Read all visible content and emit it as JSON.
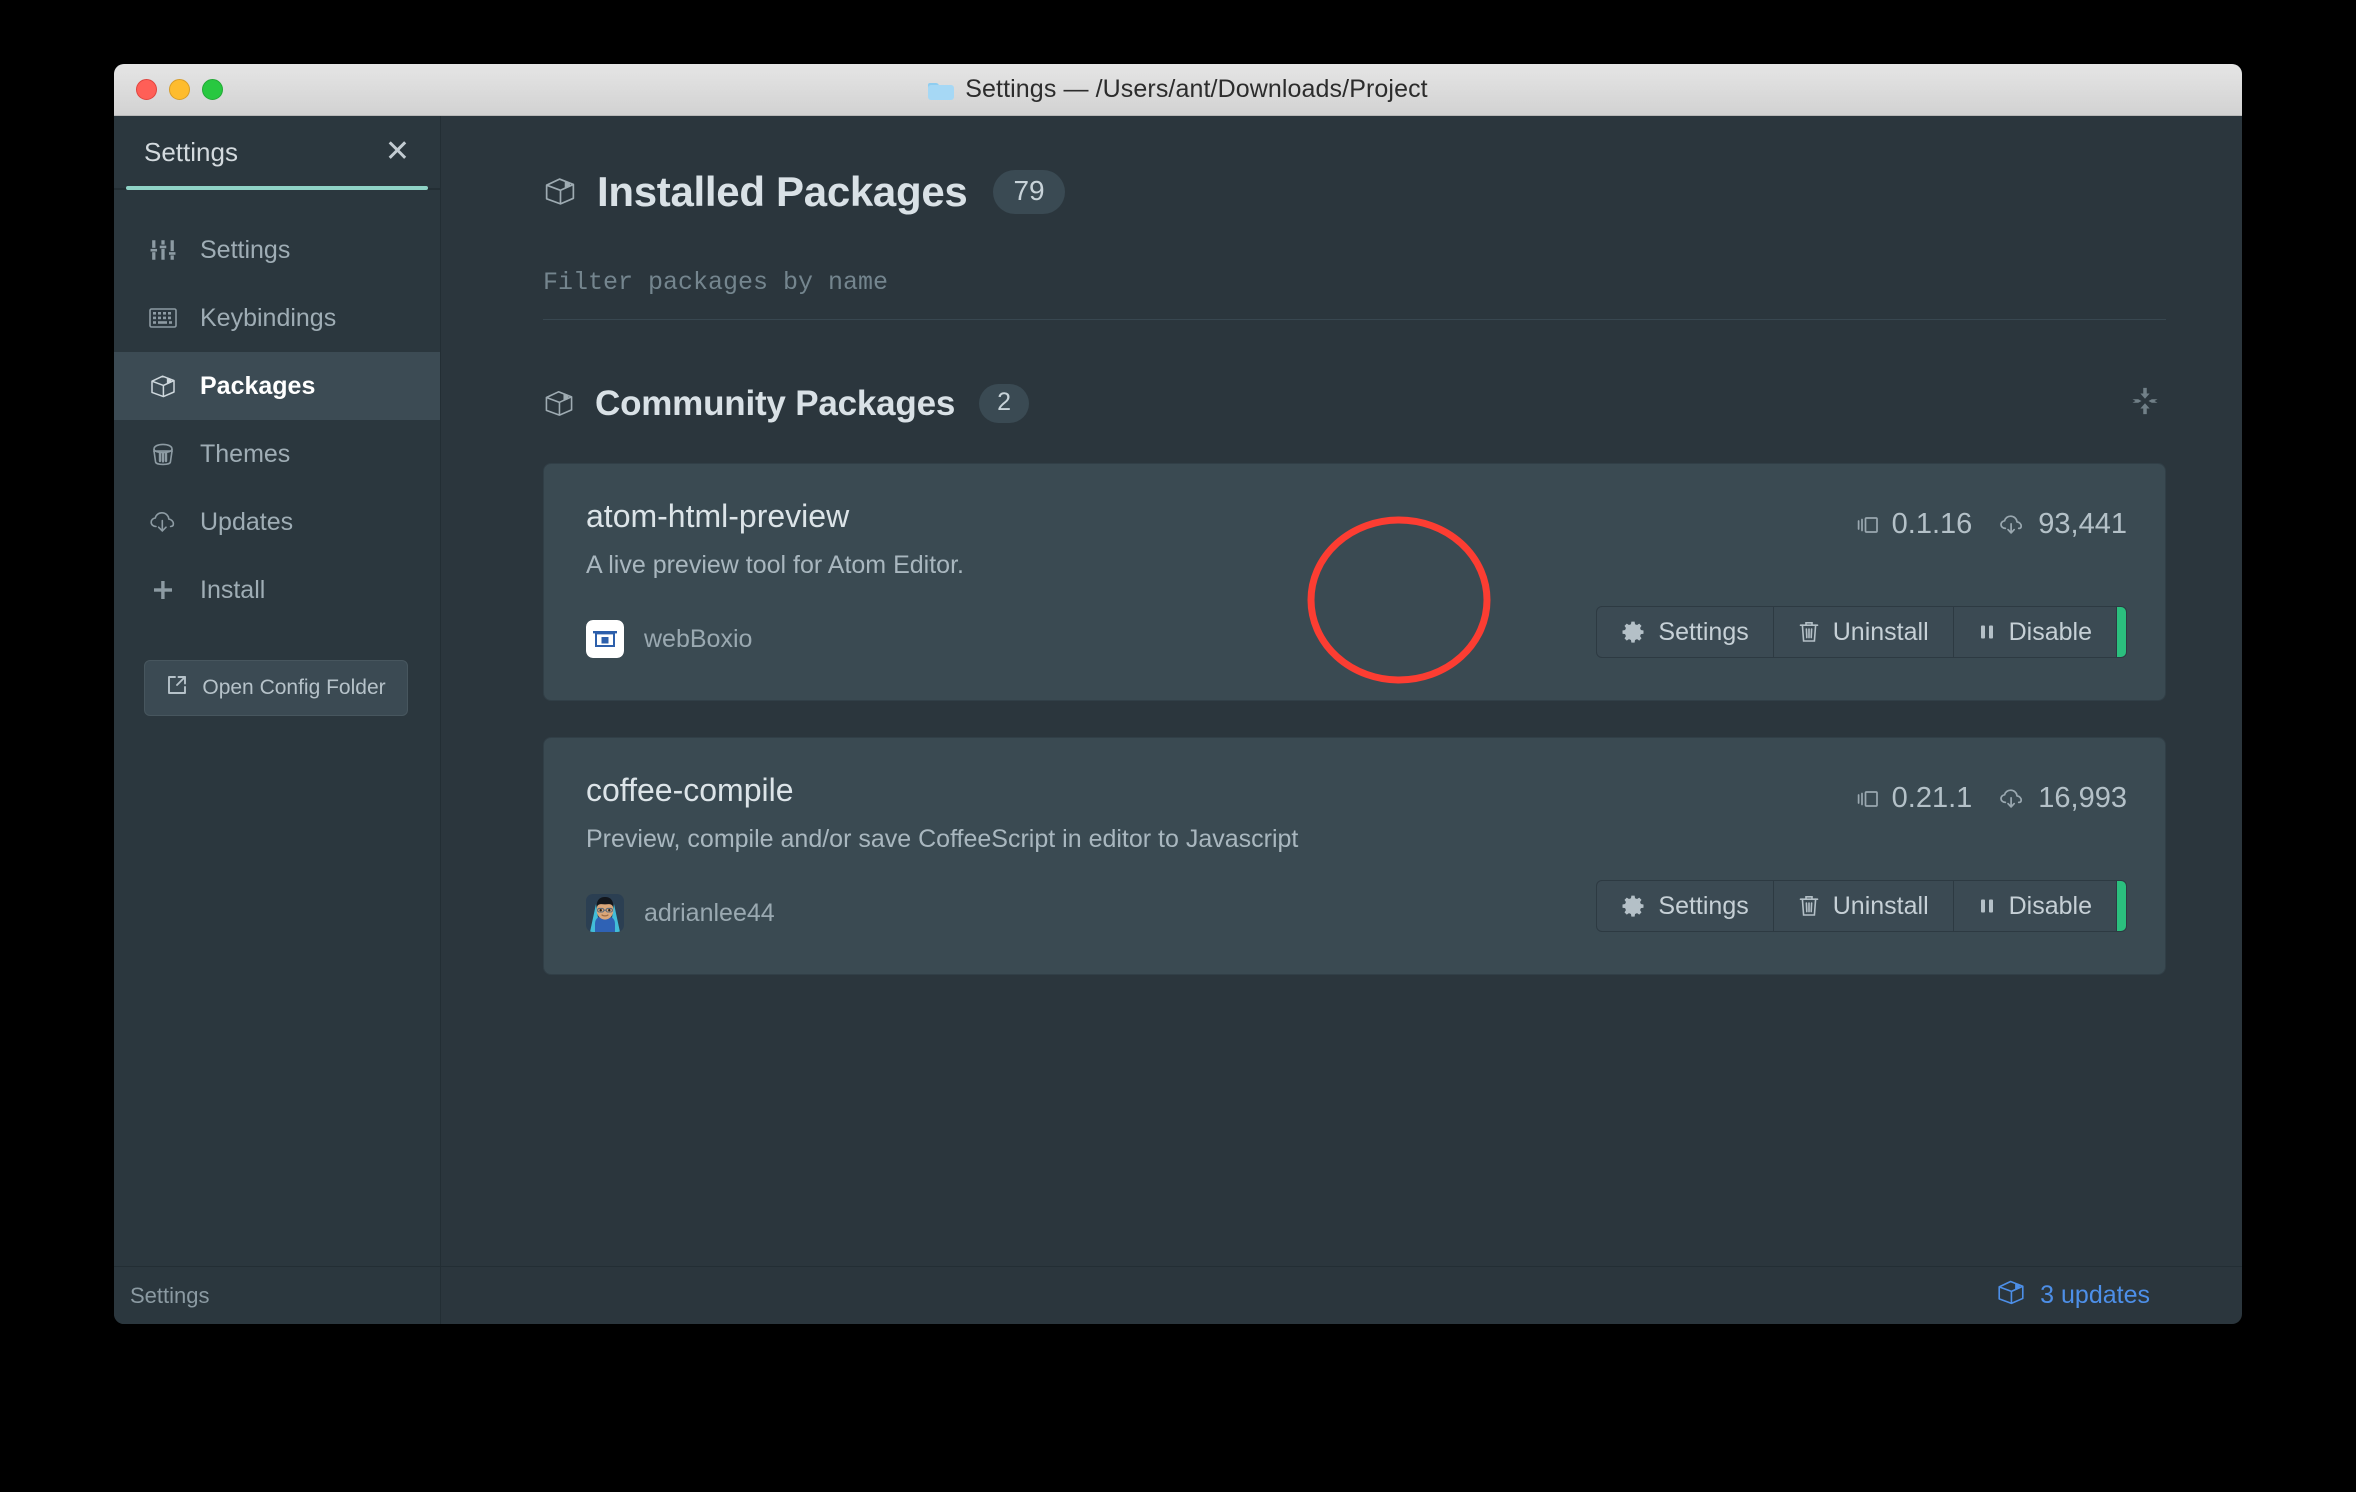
{
  "window": {
    "title": "Settings — /Users/ant/Downloads/Project",
    "folder_icon": "folder-icon",
    "traffic_lights": [
      "close",
      "minimize",
      "zoom"
    ]
  },
  "tab": {
    "label": "Settings",
    "close_icon": "close-icon",
    "accent_color": "#8fd3c6"
  },
  "sidebar": {
    "items": [
      {
        "label": "Settings",
        "icon": "sliders-icon",
        "active": false
      },
      {
        "label": "Keybindings",
        "icon": "keyboard-icon",
        "active": false
      },
      {
        "label": "Packages",
        "icon": "package-icon",
        "active": true
      },
      {
        "label": "Themes",
        "icon": "paint-can-icon",
        "active": false
      },
      {
        "label": "Updates",
        "icon": "cloud-down-icon",
        "active": false
      },
      {
        "label": "Install",
        "icon": "plus-icon",
        "active": false
      }
    ],
    "config_button": {
      "label": "Open Config Folder",
      "icon": "external-link-icon"
    }
  },
  "main": {
    "page_title": "Installed Packages",
    "page_title_icon": "package-icon",
    "installed_count": "79",
    "filter": {
      "value": "",
      "placeholder": "Filter packages by name"
    },
    "section": {
      "title": "Community Packages",
      "icon": "package-icon",
      "count": "2",
      "collapse_icon": "collapse-icon"
    },
    "packages": [
      {
        "name": "atom-html-preview",
        "description": "A live preview tool for Atom Editor.",
        "author": "webBoxio",
        "avatar": "webboxio-logo-avatar",
        "version": "0.1.16",
        "version_icon": "versions-icon",
        "downloads": "93,441",
        "downloads_icon": "cloud-download-icon",
        "buttons": [
          {
            "label": "Settings",
            "icon": "gear-icon"
          },
          {
            "label": "Uninstall",
            "icon": "trash-icon"
          },
          {
            "label": "Disable",
            "icon": "pause-icon"
          }
        ],
        "enabled_indicator_color": "#2bbf7e",
        "annotated": true
      },
      {
        "name": "coffee-compile",
        "description": "Preview, compile and/or save CoffeeScript in editor to Javascript",
        "author": "adrianlee44",
        "avatar": "adrianlee44-face-avatar",
        "version": "0.21.1",
        "version_icon": "versions-icon",
        "downloads": "16,993",
        "downloads_icon": "cloud-download-icon",
        "buttons": [
          {
            "label": "Settings",
            "icon": "gear-icon"
          },
          {
            "label": "Uninstall",
            "icon": "trash-icon"
          },
          {
            "label": "Disable",
            "icon": "pause-icon"
          }
        ],
        "enabled_indicator_color": "#2bbf7e",
        "annotated": false
      }
    ]
  },
  "statusbar": {
    "left_label": "Settings",
    "updates_label": "3 updates",
    "updates_icon": "package-icon",
    "updates_color": "#4d8fe8"
  },
  "annotation": {
    "shape": "ellipse",
    "color": "#fc3d32",
    "target": "settings-button-of-atom-html-preview"
  }
}
